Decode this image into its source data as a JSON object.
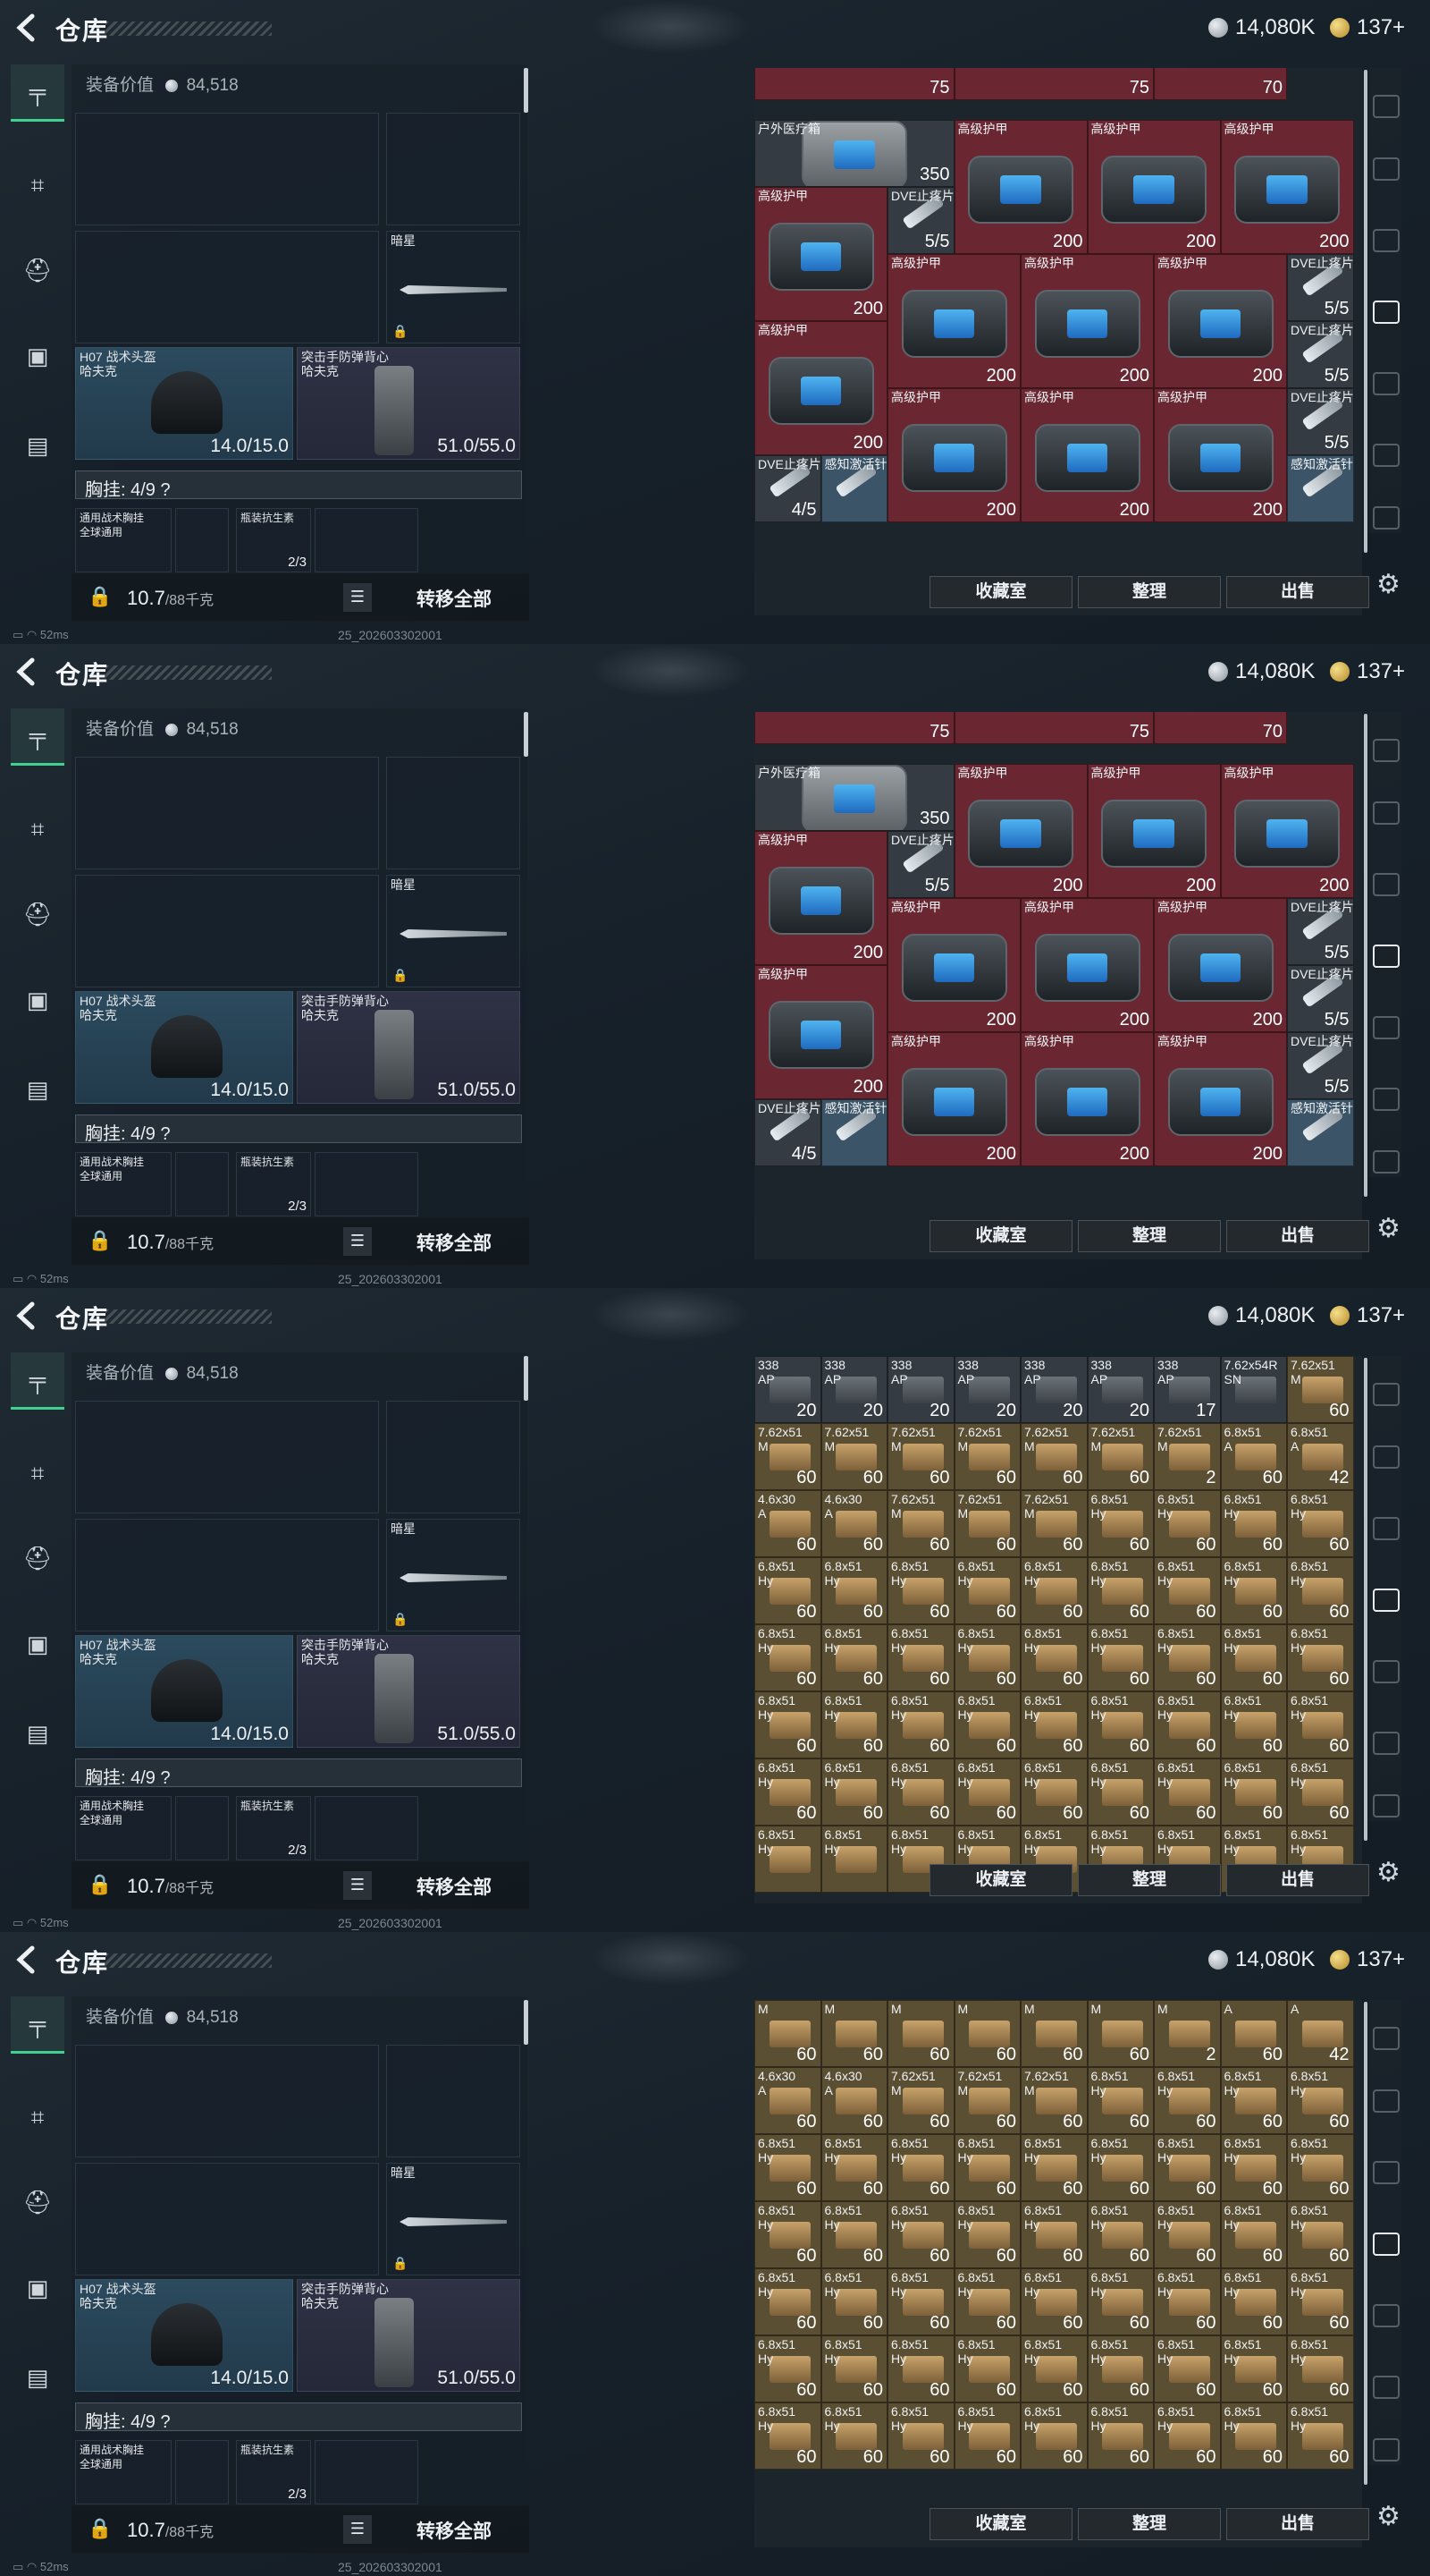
{
  "app": {
    "title": "仓库",
    "currency_silver": "14,080K",
    "currency_gold": "137+",
    "ping": "52ms",
    "version": "25_202603302001"
  },
  "equipment": {
    "value_label": "装备价值",
    "value": "84,518",
    "melee_label": "暗星",
    "helmet_label": "H07 战术头盔\n哈夫克",
    "helmet_durability": "14.0/15.0",
    "vest_label": "突击手防弹背心\n哈夫克",
    "vest_durability": "51.0/55.0",
    "rig_label": "胸挂: 4/9 ?",
    "rig_item1_label": "通用战术胸挂\n全球通用",
    "rig_item2_label": "瓶装抗生素",
    "rig_item2_count": "2/3",
    "weight_value": "10.7",
    "weight_unit": "/88千克",
    "transfer_all": "转移全部"
  },
  "buttons": {
    "collect": "收藏室",
    "sort": "整理",
    "sell": "出售"
  },
  "colors": {
    "red_cell": "#6a2731",
    "blue_cell": "#3b5468",
    "tan_cell": "#5a4e33",
    "grey_cell": "#343b42",
    "accent_green": "#3fd18e"
  },
  "screens": [
    {
      "cells": [
        {
          "c": 0,
          "r": -1,
          "w": 3,
          "h": 1,
          "label": "",
          "value": "75",
          "color": "red"
        },
        {
          "c": 3,
          "r": -1,
          "w": 3,
          "h": 1,
          "label": "",
          "value": "75",
          "color": "red"
        },
        {
          "c": 6,
          "r": -1,
          "w": 2,
          "h": 1,
          "label": "",
          "value": "70",
          "color": "red"
        },
        {
          "c": 0,
          "r": 0,
          "w": 3,
          "h": 1,
          "label": "户外医疗箱",
          "value": "350",
          "color": "grey",
          "kind": "med"
        },
        {
          "c": 3,
          "r": 0,
          "w": 2,
          "h": 2,
          "label": "高级护甲",
          "value": "200",
          "color": "red",
          "kind": "armor"
        },
        {
          "c": 5,
          "r": 0,
          "w": 2,
          "h": 2,
          "label": "高级护甲",
          "value": "200",
          "color": "red",
          "kind": "armor"
        },
        {
          "c": 7,
          "r": 0,
          "w": 2,
          "h": 2,
          "label": "高级护甲",
          "value": "200",
          "color": "red",
          "kind": "armor"
        },
        {
          "c": 0,
          "r": 1,
          "w": 2,
          "h": 2,
          "label": "高级护甲",
          "value": "200",
          "color": "red",
          "kind": "armor"
        },
        {
          "c": 2,
          "r": 1,
          "w": 1,
          "h": 1,
          "label": "DVE止疼片",
          "value": "5/5",
          "color": "grey",
          "kind": "inj"
        },
        {
          "c": 2,
          "r": 2,
          "w": 2,
          "h": 2,
          "label": "高级护甲",
          "value": "200",
          "color": "red",
          "kind": "armor"
        },
        {
          "c": 4,
          "r": 2,
          "w": 2,
          "h": 2,
          "label": "高级护甲",
          "value": "200",
          "color": "red",
          "kind": "armor"
        },
        {
          "c": 6,
          "r": 2,
          "w": 2,
          "h": 2,
          "label": "高级护甲",
          "value": "200",
          "color": "red",
          "kind": "armor"
        },
        {
          "c": 8,
          "r": 2,
          "w": 1,
          "h": 1,
          "label": "DVE止疼片",
          "value": "5/5",
          "color": "grey",
          "kind": "inj"
        },
        {
          "c": 8,
          "r": 3,
          "w": 1,
          "h": 1,
          "label": "DVE止疼片",
          "value": "5/5",
          "color": "grey",
          "kind": "inj"
        },
        {
          "c": 0,
          "r": 3,
          "w": 2,
          "h": 2,
          "label": "高级护甲",
          "value": "200",
          "color": "red",
          "kind": "armor"
        },
        {
          "c": 2,
          "r": 4,
          "w": 2,
          "h": 2,
          "label": "高级护甲",
          "value": "200",
          "color": "red",
          "kind": "armor"
        },
        {
          "c": 4,
          "r": 4,
          "w": 2,
          "h": 2,
          "label": "高级护甲",
          "value": "200",
          "color": "red",
          "kind": "armor"
        },
        {
          "c": 6,
          "r": 4,
          "w": 2,
          "h": 2,
          "label": "高级护甲",
          "value": "200",
          "color": "red",
          "kind": "armor"
        },
        {
          "c": 8,
          "r": 4,
          "w": 1,
          "h": 1,
          "label": "DVE止疼片",
          "value": "5/5",
          "color": "grey",
          "kind": "inj"
        },
        {
          "c": 8,
          "r": 5,
          "w": 1,
          "h": 1,
          "label": "感知激活针",
          "value": "",
          "color": "blue",
          "kind": "inj"
        },
        {
          "c": 0,
          "r": 5,
          "w": 1,
          "h": 1,
          "label": "DVE止疼片",
          "value": "4/5",
          "color": "grey",
          "kind": "inj"
        },
        {
          "c": 1,
          "r": 5,
          "w": 1,
          "h": 1,
          "label": "感知激活针",
          "value": "",
          "color": "blue",
          "kind": "inj"
        }
      ]
    },
    {
      "cells": [
        {
          "c": 0,
          "r": -1,
          "w": 3,
          "h": 1,
          "label": "",
          "value": "75",
          "color": "red"
        },
        {
          "c": 3,
          "r": -1,
          "w": 3,
          "h": 1,
          "label": "",
          "value": "75",
          "color": "red"
        },
        {
          "c": 6,
          "r": -1,
          "w": 2,
          "h": 1,
          "label": "",
          "value": "70",
          "color": "red"
        },
        {
          "c": 0,
          "r": 0,
          "w": 3,
          "h": 1,
          "label": "户外医疗箱",
          "value": "350",
          "color": "grey",
          "kind": "med"
        },
        {
          "c": 3,
          "r": 0,
          "w": 2,
          "h": 2,
          "label": "高级护甲",
          "value": "200",
          "color": "red",
          "kind": "armor"
        },
        {
          "c": 5,
          "r": 0,
          "w": 2,
          "h": 2,
          "label": "高级护甲",
          "value": "200",
          "color": "red",
          "kind": "armor"
        },
        {
          "c": 7,
          "r": 0,
          "w": 2,
          "h": 2,
          "label": "高级护甲",
          "value": "200",
          "color": "red",
          "kind": "armor"
        },
        {
          "c": 0,
          "r": 1,
          "w": 2,
          "h": 2,
          "label": "高级护甲",
          "value": "200",
          "color": "red",
          "kind": "armor"
        },
        {
          "c": 2,
          "r": 1,
          "w": 1,
          "h": 1,
          "label": "DVE止疼片",
          "value": "5/5",
          "color": "grey",
          "kind": "inj"
        },
        {
          "c": 2,
          "r": 2,
          "w": 2,
          "h": 2,
          "label": "高级护甲",
          "value": "200",
          "color": "red",
          "kind": "armor"
        },
        {
          "c": 4,
          "r": 2,
          "w": 2,
          "h": 2,
          "label": "高级护甲",
          "value": "200",
          "color": "red",
          "kind": "armor"
        },
        {
          "c": 6,
          "r": 2,
          "w": 2,
          "h": 2,
          "label": "高级护甲",
          "value": "200",
          "color": "red",
          "kind": "armor"
        },
        {
          "c": 8,
          "r": 2,
          "w": 1,
          "h": 1,
          "label": "DVE止疼片",
          "value": "5/5",
          "color": "grey",
          "kind": "inj"
        },
        {
          "c": 8,
          "r": 3,
          "w": 1,
          "h": 1,
          "label": "DVE止疼片",
          "value": "5/5",
          "color": "grey",
          "kind": "inj"
        },
        {
          "c": 0,
          "r": 3,
          "w": 2,
          "h": 2,
          "label": "高级护甲",
          "value": "200",
          "color": "red",
          "kind": "armor"
        },
        {
          "c": 2,
          "r": 4,
          "w": 2,
          "h": 2,
          "label": "高级护甲",
          "value": "200",
          "color": "red",
          "kind": "armor"
        },
        {
          "c": 4,
          "r": 4,
          "w": 2,
          "h": 2,
          "label": "高级护甲",
          "value": "200",
          "color": "red",
          "kind": "armor"
        },
        {
          "c": 6,
          "r": 4,
          "w": 2,
          "h": 2,
          "label": "高级护甲",
          "value": "200",
          "color": "red",
          "kind": "armor"
        },
        {
          "c": 8,
          "r": 4,
          "w": 1,
          "h": 1,
          "label": "DVE止疼片",
          "value": "5/5",
          "color": "grey",
          "kind": "inj"
        },
        {
          "c": 8,
          "r": 5,
          "w": 1,
          "h": 1,
          "label": "感知激活针",
          "value": "",
          "color": "blue",
          "kind": "inj"
        },
        {
          "c": 0,
          "r": 5,
          "w": 1,
          "h": 1,
          "label": "DVE止疼片",
          "value": "4/5",
          "color": "grey",
          "kind": "inj"
        },
        {
          "c": 1,
          "r": 5,
          "w": 1,
          "h": 1,
          "label": "感知激活针",
          "value": "",
          "color": "blue",
          "kind": "inj"
        }
      ]
    },
    {
      "rows": [
        [
          "338|AP|20",
          "338|AP|20",
          "338|AP|20",
          "338|AP|20",
          "338|AP|20",
          "338|AP|20",
          "338|AP|17",
          "7.62x54R|SN|",
          "7.62x51|M|60"
        ],
        [
          "7.62x51|M|60",
          "7.62x51|M|60",
          "7.62x51|M|60",
          "7.62x51|M|60",
          "7.62x51|M|60",
          "7.62x51|M|60",
          "7.62x51|M|2",
          "6.8x51|A|60",
          "6.8x51|A|42"
        ],
        [
          "4.6x30|A|60",
          "4.6x30|A|60",
          "7.62x51|M|60",
          "7.62x51|M|60",
          "7.62x51|M|60",
          "6.8x51|Hy|60",
          "6.8x51|Hy|60",
          "6.8x51|Hy|60",
          "6.8x51|Hy|60"
        ],
        [
          "6.8x51|Hy|60",
          "6.8x51|Hy|60",
          "6.8x51|Hy|60",
          "6.8x51|Hy|60",
          "6.8x51|Hy|60",
          "6.8x51|Hy|60",
          "6.8x51|Hy|60",
          "6.8x51|Hy|60",
          "6.8x51|Hy|60"
        ],
        [
          "6.8x51|Hy|60",
          "6.8x51|Hy|60",
          "6.8x51|Hy|60",
          "6.8x51|Hy|60",
          "6.8x51|Hy|60",
          "6.8x51|Hy|60",
          "6.8x51|Hy|60",
          "6.8x51|Hy|60",
          "6.8x51|Hy|60"
        ],
        [
          "6.8x51|Hy|60",
          "6.8x51|Hy|60",
          "6.8x51|Hy|60",
          "6.8x51|Hy|60",
          "6.8x51|Hy|60",
          "6.8x51|Hy|60",
          "6.8x51|Hy|60",
          "6.8x51|Hy|60",
          "6.8x51|Hy|60"
        ],
        [
          "6.8x51|Hy|60",
          "6.8x51|Hy|60",
          "6.8x51|Hy|60",
          "6.8x51|Hy|60",
          "6.8x51|Hy|60",
          "6.8x51|Hy|60",
          "6.8x51|Hy|60",
          "6.8x51|Hy|60",
          "6.8x51|Hy|60"
        ],
        [
          "6.8x51|Hy|",
          "6.8x51|Hy|",
          "6.8x51|Hy|",
          "6.8x51|Hy|",
          "6.8x51|Hy|",
          "6.8x51|Hy|",
          "6.8x51|Hy|",
          "6.8x51|Hy|",
          "6.8x51|Hy|"
        ]
      ]
    },
    {
      "rows": [
        [
          "|M|60",
          "|M|60",
          "|M|60",
          "|M|60",
          "|M|60",
          "|M|60",
          "|M|2",
          "|A|60",
          "|A|42"
        ],
        [
          "4.6x30|A|60",
          "4.6x30|A|60",
          "7.62x51|M|60",
          "7.62x51|M|60",
          "7.62x51|M|60",
          "6.8x51|Hy|60",
          "6.8x51|Hy|60",
          "6.8x51|Hy|60",
          "6.8x51|Hy|60"
        ],
        [
          "6.8x51|Hy|60",
          "6.8x51|Hy|60",
          "6.8x51|Hy|60",
          "6.8x51|Hy|60",
          "6.8x51|Hy|60",
          "6.8x51|Hy|60",
          "6.8x51|Hy|60",
          "6.8x51|Hy|60",
          "6.8x51|Hy|60"
        ],
        [
          "6.8x51|Hy|60",
          "6.8x51|Hy|60",
          "6.8x51|Hy|60",
          "6.8x51|Hy|60",
          "6.8x51|Hy|60",
          "6.8x51|Hy|60",
          "6.8x51|Hy|60",
          "6.8x51|Hy|60",
          "6.8x51|Hy|60"
        ],
        [
          "6.8x51|Hy|60",
          "6.8x51|Hy|60",
          "6.8x51|Hy|60",
          "6.8x51|Hy|60",
          "6.8x51|Hy|60",
          "6.8x51|Hy|60",
          "6.8x51|Hy|60",
          "6.8x51|Hy|60",
          "6.8x51|Hy|60"
        ],
        [
          "6.8x51|Hy|60",
          "6.8x51|Hy|60",
          "6.8x51|Hy|60",
          "6.8x51|Hy|60",
          "6.8x51|Hy|60",
          "6.8x51|Hy|60",
          "6.8x51|Hy|60",
          "6.8x51|Hy|60",
          "6.8x51|Hy|60"
        ],
        [
          "6.8x51|Hy|60",
          "6.8x51|Hy|60",
          "6.8x51|Hy|60",
          "6.8x51|Hy|60",
          "6.8x51|Hy|60",
          "6.8x51|Hy|60",
          "6.8x51|Hy|60",
          "6.8x51|Hy|60",
          "6.8x51|Hy|60"
        ]
      ]
    }
  ]
}
